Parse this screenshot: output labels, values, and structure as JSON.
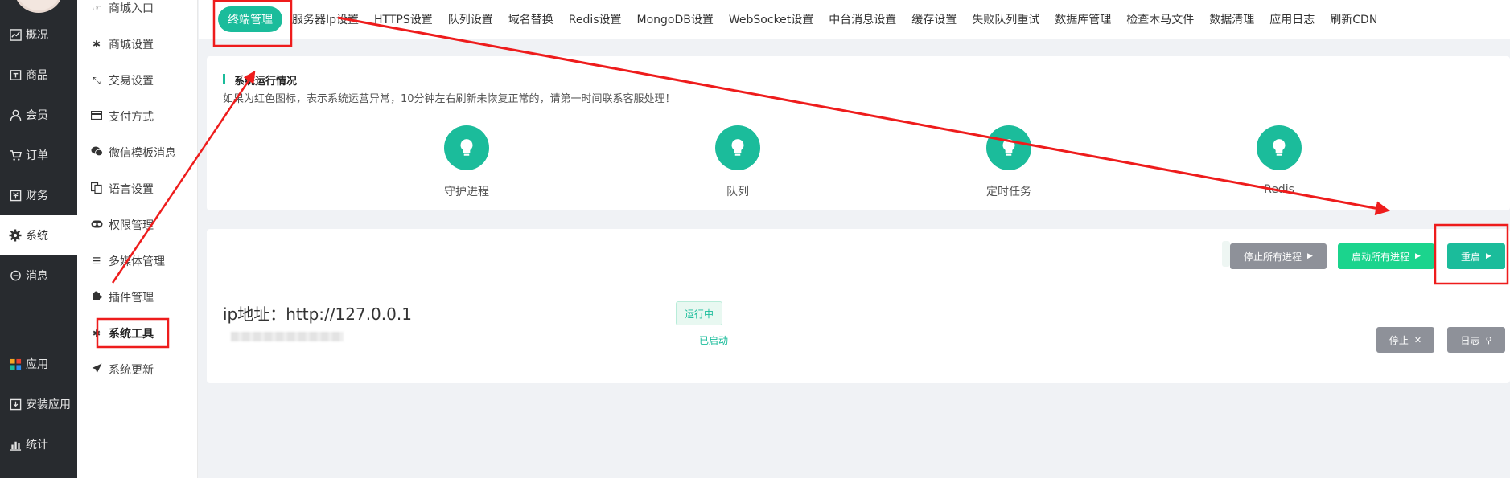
{
  "sidebar": {
    "items": [
      {
        "icon": "chart-icon",
        "label": "概况"
      },
      {
        "icon": "shop-icon",
        "label": "商品"
      },
      {
        "icon": "user-icon",
        "label": "会员"
      },
      {
        "icon": "cart-icon",
        "label": "订单"
      },
      {
        "icon": "finance-icon",
        "label": "财务"
      },
      {
        "icon": "gear-icon",
        "label": "系统"
      },
      {
        "icon": "message-icon",
        "label": "消息"
      },
      {
        "icon": "apps-icon",
        "label": "应用"
      },
      {
        "icon": "install-icon",
        "label": "安装应用"
      },
      {
        "icon": "stats-icon",
        "label": "统计"
      }
    ],
    "active": "系统"
  },
  "submenu": {
    "items": [
      {
        "icon": "pointer-icon",
        "label": "商城入口"
      },
      {
        "icon": "gear-icon",
        "label": "商城设置"
      },
      {
        "icon": "exchange-icon",
        "label": "交易设置"
      },
      {
        "icon": "card-icon",
        "label": "支付方式"
      },
      {
        "icon": "wechat-icon",
        "label": "微信模板消息"
      },
      {
        "icon": "language-icon",
        "label": "语言设置"
      },
      {
        "icon": "permission-icon",
        "label": "权限管理"
      },
      {
        "icon": "list-icon",
        "label": "多媒体管理"
      },
      {
        "icon": "puzzle-icon",
        "label": "插件管理"
      },
      {
        "icon": "tools-icon",
        "label": "系统工具"
      },
      {
        "icon": "send-icon",
        "label": "系统更新"
      }
    ],
    "active": "系统工具"
  },
  "tabs": [
    "终端管理",
    "服务器Ip设置",
    "HTTPS设置",
    "队列设置",
    "域名替换",
    "Redis设置",
    "MongoDB设置",
    "WebSocket设置",
    "中台消息设置",
    "缓存设置",
    "失败队列重试",
    "数据库管理",
    "检查木马文件",
    "数据清理",
    "应用日志",
    "刷新CDN"
  ],
  "active_tab": "终端管理",
  "status": {
    "title": "系统运行情况",
    "note": "如果为红色图标，表示系统运营异常，10分钟左右刷新未恢复正常的，请第一时间联系客服处理！",
    "items": [
      "守护进程",
      "队列",
      "定时任务",
      "Redis"
    ],
    "color": "#1bbc9b"
  },
  "process": {
    "buttons": {
      "stop_all": "停止所有进程",
      "start_all": "启动所有进程",
      "restart": "重启",
      "stop": "停止",
      "log": "日志"
    },
    "ip": "ip地址：http://127.0.0.1",
    "running_badge": "运行中",
    "started": "已启动"
  }
}
